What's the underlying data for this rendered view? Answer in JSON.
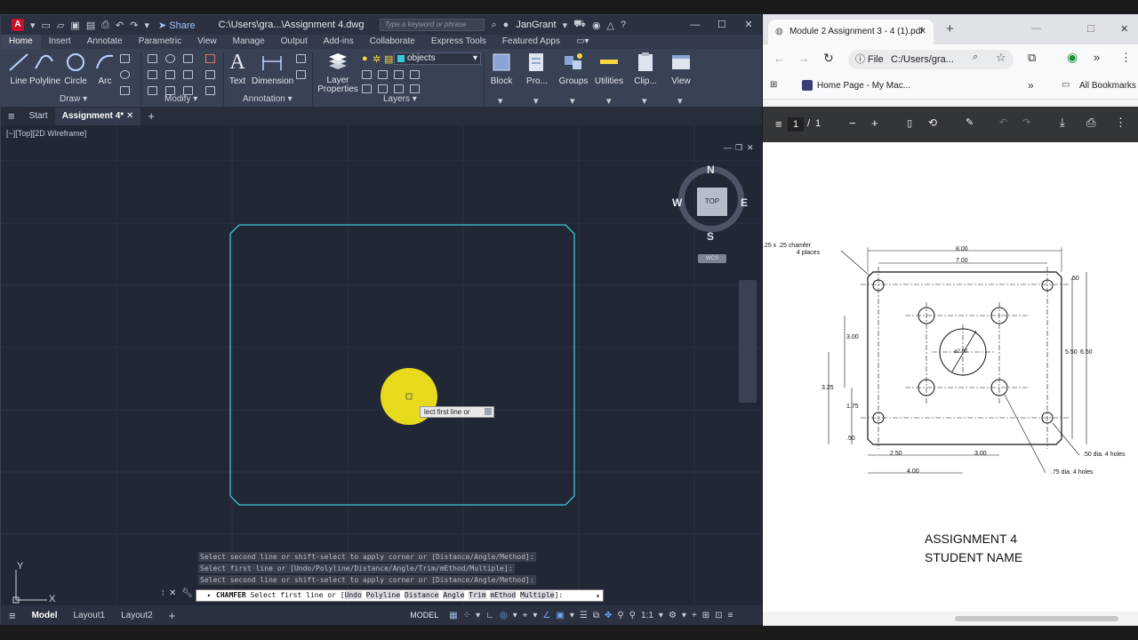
{
  "acad": {
    "title_path": "C:\\Users\\gra...\\Assignment 4.dwg",
    "share_label": "Share",
    "search_placeholder": "Type a keyword or phrase",
    "user": "JanGrant",
    "ribbon_tabs": [
      "Home",
      "Insert",
      "Annotate",
      "Parametric",
      "View",
      "Manage",
      "Output",
      "Add-ins",
      "Collaborate",
      "Express Tools",
      "Featured Apps"
    ],
    "draw_tools": [
      "Line",
      "Polyline",
      "Circle",
      "Arc"
    ],
    "panel_draw": "Draw",
    "panel_modify": "Modify",
    "panel_annotation": "Annotation",
    "panel_layers": "Layers",
    "tool_text": "Text",
    "tool_dimension": "Dimension",
    "tool_layer_properties_1": "Layer",
    "tool_layer_properties_2": "Properties",
    "layer_current": "objects",
    "tool_block": "Block",
    "tool_properties": "Pro...",
    "tool_groups": "Groups",
    "tool_utilities": "Utilities",
    "tool_clipboard": "Clip...",
    "tool_view": "View",
    "file_tabs": [
      "Start",
      "Assignment 4*"
    ],
    "view_label": "[−][Top][2D Wireframe]",
    "viewcube": {
      "top": "TOP",
      "n": "N",
      "s": "S",
      "e": "E",
      "w": "W",
      "wcs": "WCS"
    },
    "tooltip": "lect first line or",
    "ucs_x": "X",
    "ucs_y": "Y",
    "command_history": [
      "Select second line or shift-select to apply corner or [Distance/Angle/Method]:",
      "Select first line or [Undo/Polyline/Distance/Angle/Trim/mEthod/Multiple]:",
      "Select second line or shift-select to apply corner or [Distance/Angle/Method]:"
    ],
    "command_name": "CHAMFER",
    "command_prompt": "Select first line or [",
    "command_options": [
      "Undo",
      "Polyline",
      "Distance",
      "Angle",
      "Trim",
      "mEthod",
      "Multiple"
    ],
    "command_end": "]:",
    "layout_tabs": [
      "Model",
      "Layout1",
      "Layout2"
    ],
    "status_model": "MODEL",
    "status_scale": "1:1"
  },
  "browser": {
    "tab_title": "Module 2 Assignment 3 - 4 (1).pdf",
    "file_chip": "File",
    "url": "C:/Users/gra...",
    "bookmark_1": "Home Page - My Mac...",
    "all_bookmarks": "All Bookmarks",
    "page_current": "1",
    "page_sep": "/",
    "page_total": "1"
  },
  "pdf": {
    "chamfer_note_1": ".25 x .25 chamfer",
    "chamfer_note_2": "4 places",
    "dim_800": "8.00",
    "dim_700": "7.00",
    "dim_050_top": ".50",
    "dim_300_left": "3.00",
    "dim_325": "3.25",
    "dim_175": "1.75",
    "dim_050_left": ".50",
    "dim_550": "5.50",
    "dim_650": "6.50",
    "dim_200": "ø2.00",
    "dim_250": "2.50",
    "dim_300_bottom": "3.00",
    "dim_400": "4.00",
    "note_small_holes": ".50 dia. 4 holes",
    "note_large_holes": ".75 dia. 4 holes",
    "title_1": "ASSIGNMENT 4",
    "title_2": "STUDENT NAME"
  },
  "colors": {
    "rect_stroke": "#3fc7d2",
    "cursor_highlight": "#f2e31b",
    "canvas_bg": "#212735"
  }
}
